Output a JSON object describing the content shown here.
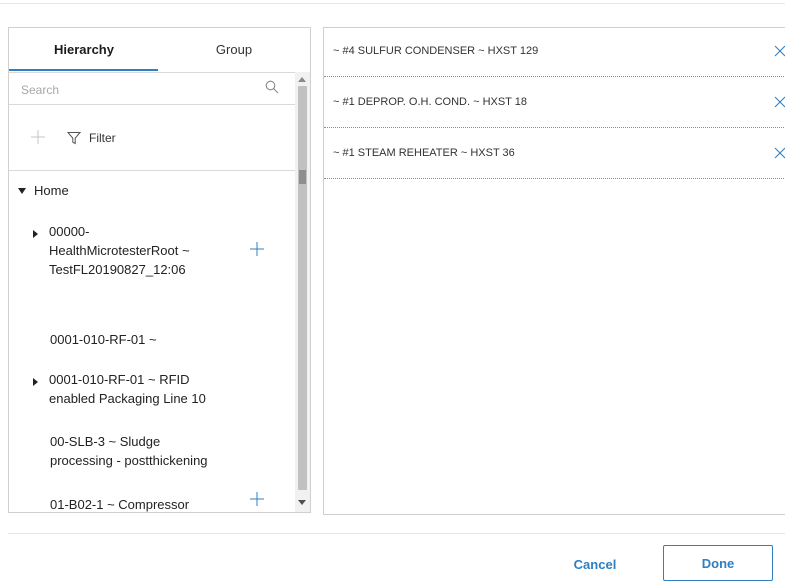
{
  "tabs": [
    {
      "label": "Hierarchy",
      "active": true
    },
    {
      "label": "Group",
      "active": false
    }
  ],
  "search": {
    "placeholder": "Search",
    "value": ""
  },
  "toolbar": {
    "filter_label": "Filter"
  },
  "tree": {
    "root_label": "Home",
    "nodes": [
      {
        "label": "00000-\nHealthMicrotesterRoot ~\nTestFL20190827_12:06",
        "expandable": true,
        "has_add": true
      },
      {
        "label": "0001-010-RF-01 ~",
        "expandable": false,
        "has_add": false
      },
      {
        "label": "0001-010-RF-01 ~ RFID\nenabled Packaging Line 10",
        "expandable": true,
        "has_add": false
      },
      {
        "label": "00-SLB-3 ~ Sludge\nprocessing - postthickening",
        "expandable": false,
        "has_add": false
      },
      {
        "label": "01-B02-1 ~ Compressor",
        "expandable": false,
        "has_add": true
      }
    ]
  },
  "selected": [
    {
      "label": "~ #4 SULFUR CONDENSER ~ HXST 129"
    },
    {
      "label": "~ #1 DEPROP. O.H. COND. ~ HXST 18"
    },
    {
      "label": "~ #1 STEAM REHEATER ~ HXST 36"
    }
  ],
  "footer": {
    "cancel_label": "Cancel",
    "done_label": "Done"
  },
  "colors": {
    "accent": "#2f7fc1",
    "border": "#cfcfcf",
    "text": "#2b2b2b"
  },
  "icons": {
    "search": "search-icon",
    "add": "plus-icon",
    "filter": "filter-icon",
    "remove": "close-icon",
    "expand": "caret-right-icon",
    "collapse": "caret-down-icon"
  }
}
